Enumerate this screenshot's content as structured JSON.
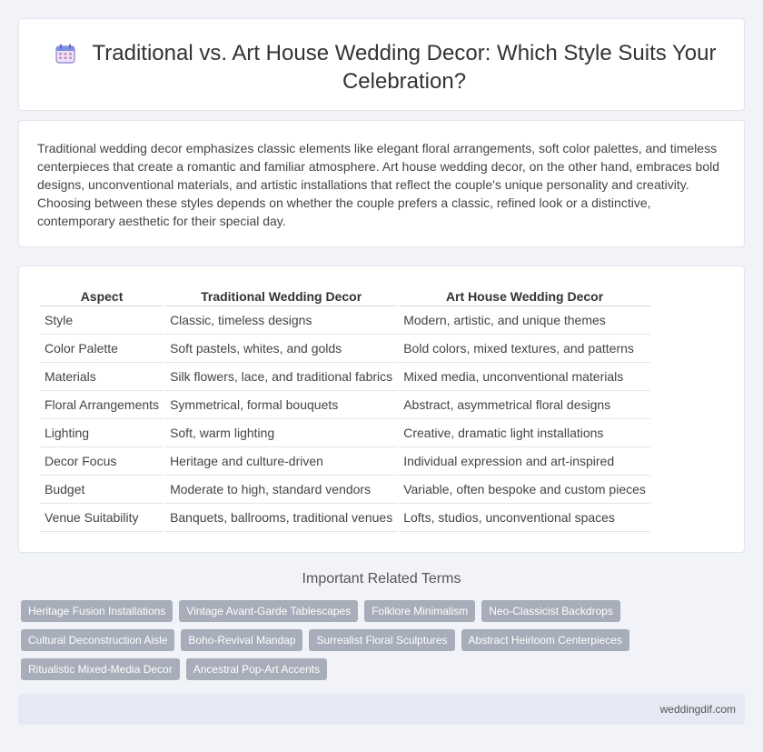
{
  "header": {
    "title": "Traditional vs. Art House Wedding Decor: Which Style Suits Your Celebration?",
    "icon": "calendar-icon"
  },
  "intro": {
    "text": "Traditional wedding decor emphasizes classic elements like elegant floral arrangements, soft color palettes, and timeless centerpieces that create a romantic and familiar atmosphere. Art house wedding decor, on the other hand, embraces bold designs, unconventional materials, and artistic installations that reflect the couple's unique personality and creativity. Choosing between these styles depends on whether the couple prefers a classic, refined look or a distinctive, contemporary aesthetic for their special day."
  },
  "table": {
    "headers": [
      "Aspect",
      "Traditional Wedding Decor",
      "Art House Wedding Decor"
    ],
    "rows": [
      [
        "Style",
        "Classic, timeless designs",
        "Modern, artistic, and unique themes"
      ],
      [
        "Color Palette",
        "Soft pastels, whites, and golds",
        "Bold colors, mixed textures, and patterns"
      ],
      [
        "Materials",
        "Silk flowers, lace, and traditional fabrics",
        "Mixed media, unconventional materials"
      ],
      [
        "Floral Arrangements",
        "Symmetrical, formal bouquets",
        "Abstract, asymmetrical floral designs"
      ],
      [
        "Lighting",
        "Soft, warm lighting",
        "Creative, dramatic light installations"
      ],
      [
        "Decor Focus",
        "Heritage and culture-driven",
        "Individual expression and art-inspired"
      ],
      [
        "Budget",
        "Moderate to high, standard vendors",
        "Variable, often bespoke and custom pieces"
      ],
      [
        "Venue Suitability",
        "Banquets, ballrooms, traditional venues",
        "Lofts, studios, unconventional spaces"
      ]
    ]
  },
  "related": {
    "heading": "Important Related Terms",
    "rows": [
      [
        "Heritage Fusion Installations",
        "Vintage Avant-Garde Tablescapes",
        "Folklore Minimalism",
        "Neo-Classicist Backdrops"
      ],
      [
        "Cultural Deconstruction Aisle",
        "Boho-Revival Mandap",
        "Surrealist Floral Sculptures",
        "Abstract Heirloom Centerpieces"
      ],
      [
        "Ritualistic Mixed-Media Decor",
        "Ancestral Pop-Art Accents"
      ]
    ]
  },
  "footer": {
    "site": "weddingdif.com"
  },
  "colors": {
    "tag_bg": "#a7adb9",
    "footer_bg": "#e6e9f4",
    "page_bg": "#f1f3f8"
  }
}
